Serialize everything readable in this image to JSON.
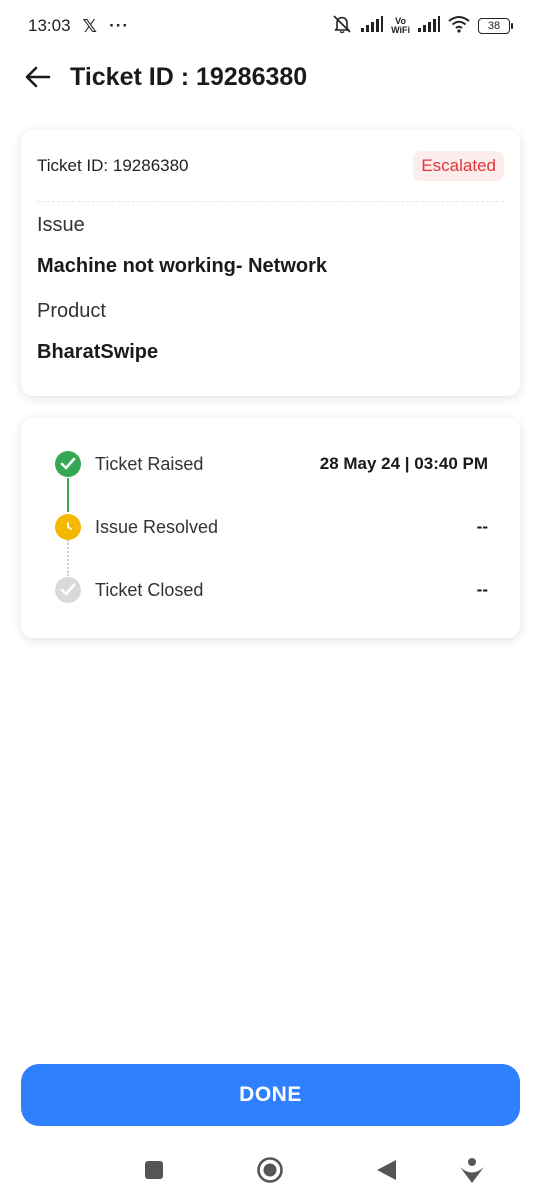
{
  "status_bar": {
    "time": "13:03",
    "x_glyph": "𝕏",
    "more": "···",
    "vo": "Vo",
    "wifi_text": "WiFi",
    "battery": "38",
    "icons": [
      "mute-icon",
      "signal-icon",
      "vowifi-icon",
      "wifi-icon",
      "battery-icon"
    ]
  },
  "header": {
    "title": "Ticket ID : 19286380",
    "back_icon": "arrow-left-icon"
  },
  "ticket_card": {
    "ticket_id_text": "Ticket ID: 19286380",
    "status": "Escalated",
    "issue_label": "Issue",
    "issue_value": "Machine not working- Network",
    "product_label": "Product",
    "product_value": "BharatSwipe"
  },
  "timeline": {
    "steps": [
      {
        "label": "Ticket Raised",
        "value": "28 May 24 | 03:40 PM",
        "state": "done",
        "icon": "check-circle-icon"
      },
      {
        "label": "Issue Resolved",
        "value": "--",
        "state": "pending",
        "icon": "clock-icon"
      },
      {
        "label": "Ticket Closed",
        "value": "--",
        "state": "inactive",
        "icon": "check-circle-icon"
      }
    ]
  },
  "done_button": {
    "label": "DONE"
  },
  "colors": {
    "primary": "#2f80ff",
    "escalated_text": "#e0353a",
    "escalated_bg": "#fdecec",
    "success": "#34a853",
    "pending": "#f5b800",
    "inactive": "#d9d9d9"
  }
}
